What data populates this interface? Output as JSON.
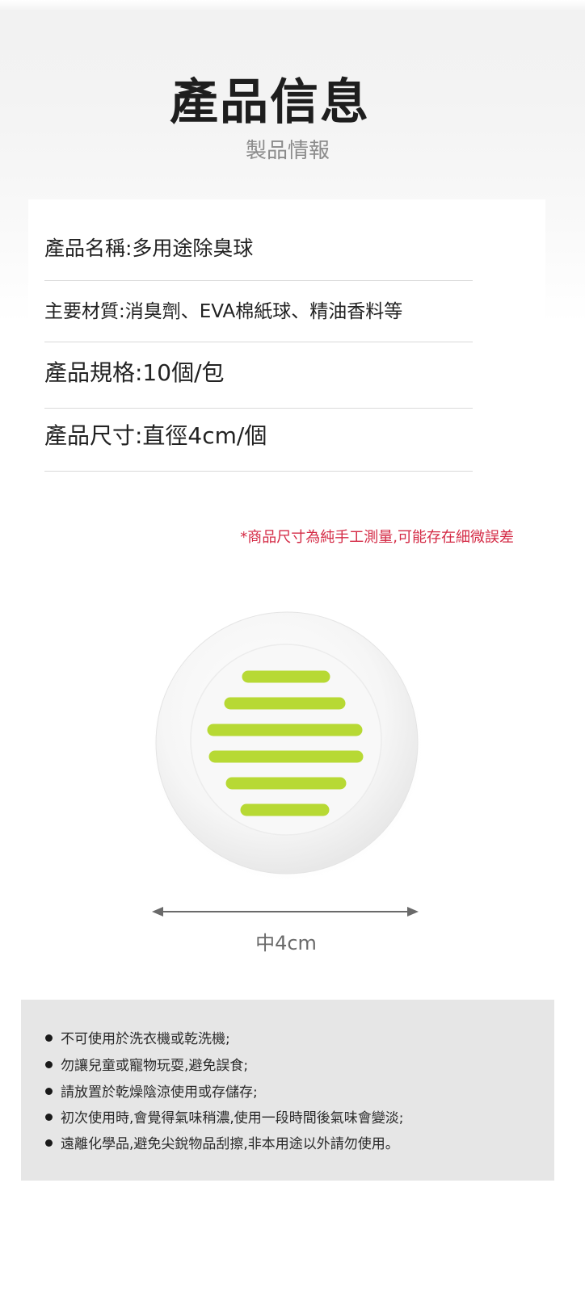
{
  "header": {
    "title": "產品信息",
    "subtitle": "製品情報"
  },
  "specs": [
    {
      "label": "產品名稱:多用途除臭球"
    },
    {
      "label": "主要材質:消臭劑、EVA棉紙球、精油香料等"
    },
    {
      "label": "產品規格:10個/包"
    },
    {
      "label": "產品尺寸:直徑4cm/個"
    }
  ],
  "disclaimer": "*商品尺寸為純手工測量,可能存在細微誤差",
  "product": {
    "icon": "deodorizer-ball-image",
    "colors": {
      "stripe": "#b7d934",
      "ball": "#f7f7f7"
    }
  },
  "size_label": "中4cm",
  "notes": [
    "不可使用於洗衣機或乾洗機;",
    "勿讓兒童或寵物玩耍,避免誤食;",
    "請放置於乾燥陰涼使用或存儲存;",
    "初次使用時,會覺得氣味稍濃,使用一段時間後氣味會變淡;",
    "遠離化學品,避免尖銳物品刮擦,非本用途以外請勿使用。"
  ]
}
